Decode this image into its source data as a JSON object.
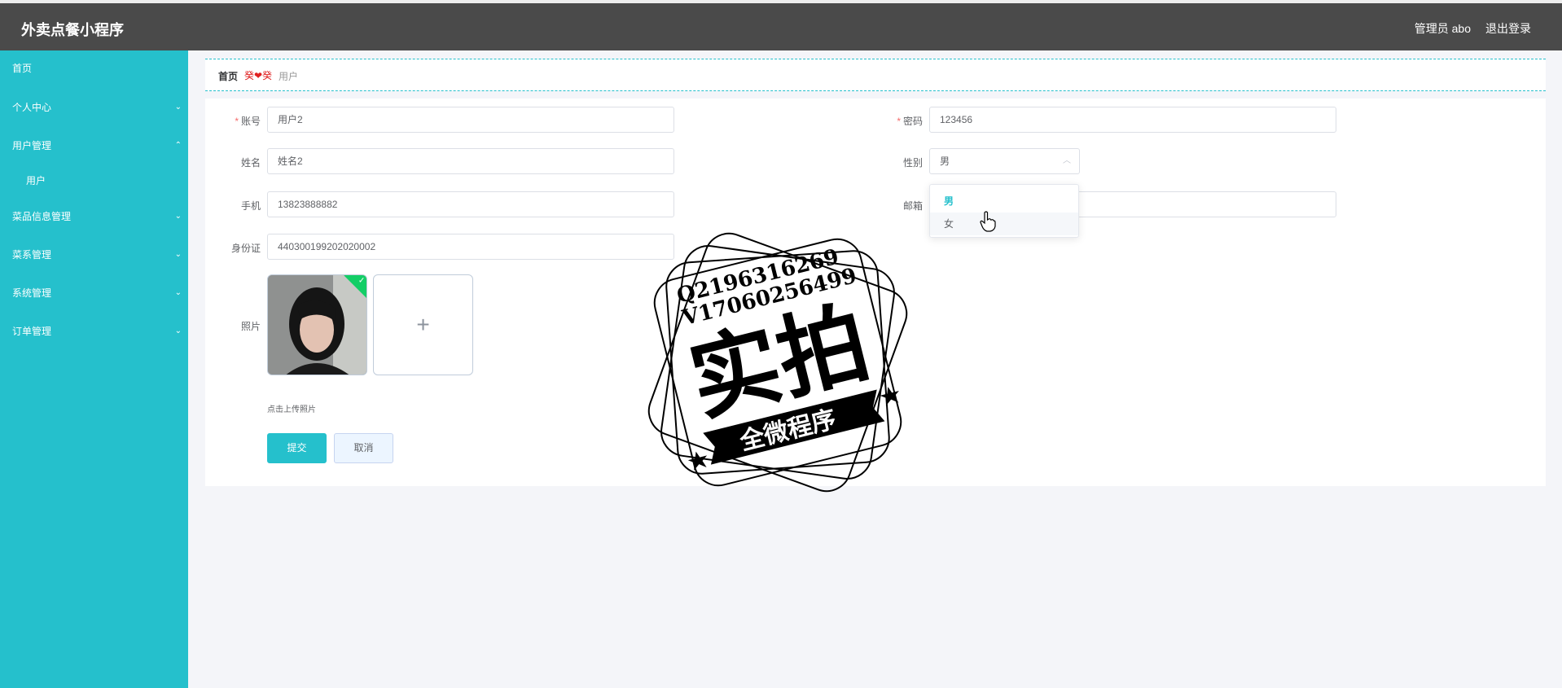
{
  "header": {
    "app_title": "外卖点餐小程序",
    "admin_label": "管理员 abo",
    "logout_label": "退出登录"
  },
  "sidebar": {
    "items": [
      {
        "label": "首页",
        "chevron": ""
      },
      {
        "label": "个人中心",
        "chevron": "⌄"
      },
      {
        "label": "用户管理",
        "chevron": "⌃"
      },
      {
        "label": "用户",
        "chevron": ""
      },
      {
        "label": "菜品信息管理",
        "chevron": "⌄"
      },
      {
        "label": "菜系管理",
        "chevron": "⌄"
      },
      {
        "label": "系统管理",
        "chevron": "⌄"
      },
      {
        "label": "订单管理",
        "chevron": "⌄"
      }
    ]
  },
  "breadcrumb": {
    "home": "首页",
    "separator": "癸❤癸",
    "current": "用户"
  },
  "form": {
    "account": {
      "label": "账号",
      "value": "用户2"
    },
    "password": {
      "label": "密码",
      "value": "123456"
    },
    "name": {
      "label": "姓名",
      "value": "姓名2"
    },
    "gender": {
      "label": "性别",
      "value": "男",
      "options": [
        "男",
        "女"
      ]
    },
    "phone": {
      "label": "手机",
      "value": "13823888882"
    },
    "email": {
      "label": "邮箱",
      "value": ""
    },
    "id_card": {
      "label": "身份证",
      "value": "440300199202020002"
    },
    "photo": {
      "label": "照片",
      "tip": "点击上传照片",
      "plus": "+",
      "check": "✓"
    },
    "submit_label": "提交",
    "cancel_label": "取消"
  },
  "watermark": {
    "line1": "Q2196316269",
    "line2": "V17060256499",
    "big": "实拍",
    "banner": "全微程序"
  },
  "colors": {
    "accent": "#25c0cc",
    "topbar": "#4a4a4a",
    "required": "#f56c6c",
    "success": "#13ce66"
  }
}
